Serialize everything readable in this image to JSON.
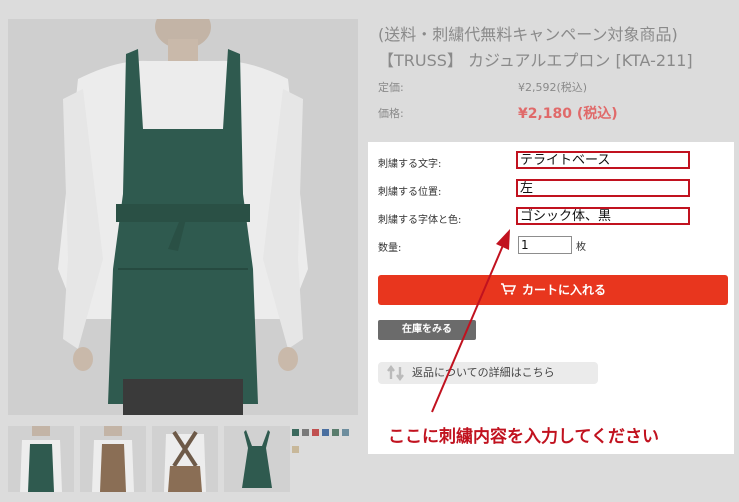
{
  "product": {
    "title_line1": "(送料・刺繍代無料キャンペーン対象商品)",
    "title_line2": "【TRUSS】 カジュアルエプロン [KTA-211]",
    "list_price_label": "定価:",
    "list_price": "¥2,592(税込)",
    "price_label": "価格:",
    "price": "¥2,180 (税込)"
  },
  "form": {
    "text_label": "刺繍する文字:",
    "text_value": "テライトベース",
    "position_label": "刺繍する位置:",
    "position_value": "左",
    "font_label": "刺繍する字体と色:",
    "font_value": "ゴシック体、黒",
    "qty_label": "数量:",
    "qty_value": "1",
    "qty_unit": "枚"
  },
  "actions": {
    "cart_label": "カートに入れる",
    "stock_label": "在庫をみる",
    "return_label": "返品についての詳細はこちら"
  },
  "annotation": {
    "text": "ここに刺繍内容を入力してください",
    "color": "#c1121f"
  },
  "colors": {
    "accent": "#e8361e",
    "apron_green": "#2f5a4f",
    "apron_brown": "#8a6e55"
  },
  "swatches": [
    "#3c6a5e",
    "#7a7a7a",
    "#c05050",
    "#4a6fa0",
    "#5a7d6d",
    "#6e8e9e",
    "#c8b89a"
  ]
}
